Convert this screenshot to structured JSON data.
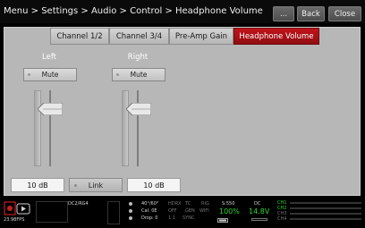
{
  "header": {
    "breadcrumb": "Menu > Settings > Audio > Control > Headphone Volume",
    "more_label": "...",
    "back_label": "Back",
    "close_label": "Close"
  },
  "tabs": [
    {
      "label": "Channel 1/2",
      "active": false
    },
    {
      "label": "Channel 3/4",
      "active": false
    },
    {
      "label": "Pre-Amp Gain",
      "active": false
    },
    {
      "label": "Headphone Volume",
      "active": true
    }
  ],
  "left": {
    "label": "Left",
    "mute_label": "Mute",
    "value": "10 dB",
    "level_fraction": 0.35
  },
  "right": {
    "label": "Right",
    "mute_label": "Mute",
    "value": "10 dB",
    "level_fraction": 0.35
  },
  "link_label": "Link",
  "colors": {
    "active_tab": "#b01218",
    "panel": "#b7b7b7",
    "status_green": "#2ed62e"
  },
  "status": {
    "rec_icon": "record-icon",
    "fps": "23.98FPS",
    "media": "DC2/RG4",
    "shutter": "40°/60°",
    "cal": "Cal: 0E",
    "drop": "Drop: 0",
    "col1": [
      "HDRX",
      "OFF",
      "1:1"
    ],
    "col2": [
      "TC",
      "GEN",
      "SYNC"
    ],
    "col3": [
      "RIG",
      "WIFI",
      ""
    ],
    "iso_label": "S:550",
    "percent": "100%",
    "dc_label": "DC",
    "voltage": "14.8V",
    "channels": [
      "CH1",
      "CH2",
      "CH3",
      "CH4"
    ]
  }
}
